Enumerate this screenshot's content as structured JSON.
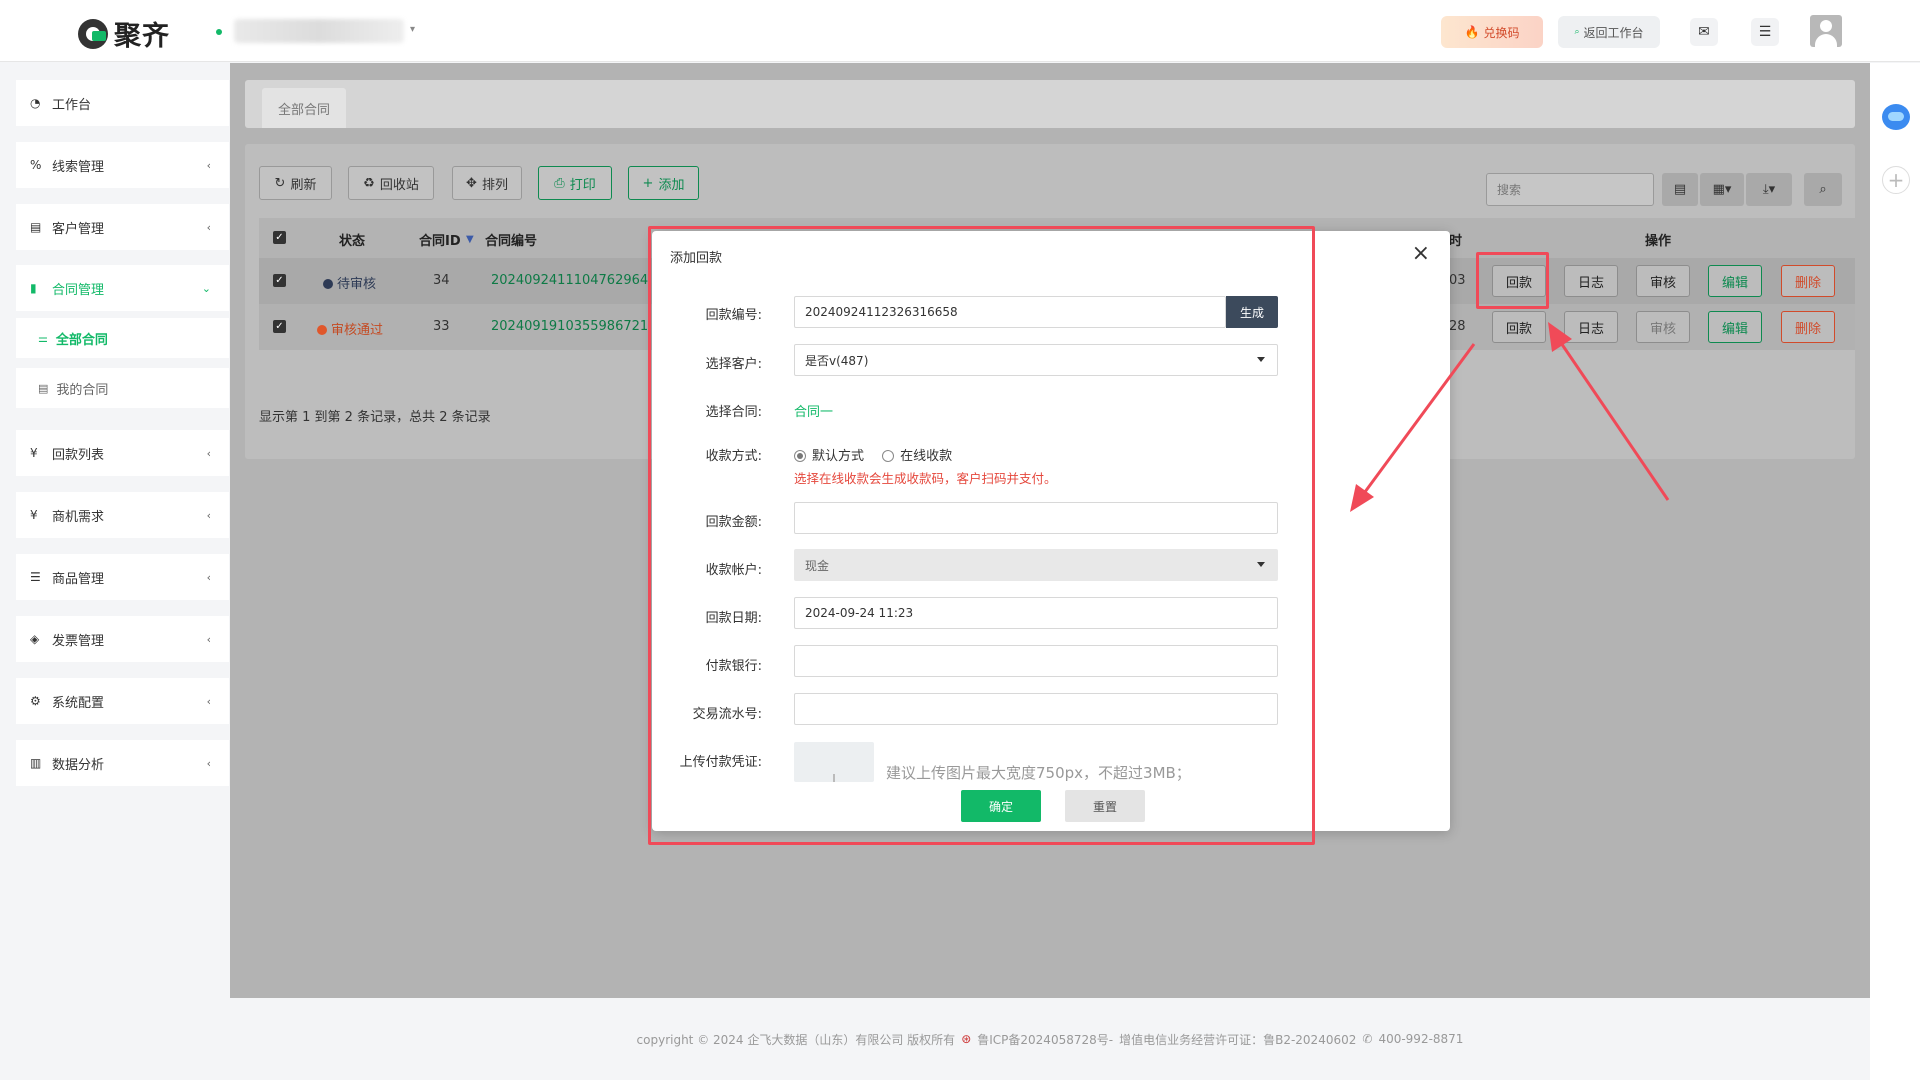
{
  "header": {
    "logo_text": "聚齐",
    "redeem_label": "兑换码",
    "back_label": "返回工作台"
  },
  "sidebar": {
    "items": [
      {
        "label": "工作台",
        "icon": "dashboard-icon"
      },
      {
        "label": "线索管理",
        "icon": "link-icon"
      },
      {
        "label": "客户管理",
        "icon": "id-card-icon"
      },
      {
        "label": "合同管理",
        "icon": "bookmark-icon"
      },
      {
        "label": "回款列表",
        "icon": "yen-icon"
      },
      {
        "label": "商机需求",
        "icon": "yen-icon"
      },
      {
        "label": "商品管理",
        "icon": "list-icon"
      },
      {
        "label": "发票管理",
        "icon": "tag-icon"
      },
      {
        "label": "系统配置",
        "icon": "gears-icon"
      },
      {
        "label": "数据分析",
        "icon": "bar-chart-icon"
      }
    ],
    "sub_items": [
      {
        "label": "全部合同"
      },
      {
        "label": "我的合同"
      }
    ]
  },
  "tabs": [
    "全部合同"
  ],
  "toolbar": {
    "refresh": "刷新",
    "recycle": "回收站",
    "sort": "排列",
    "print": "打印",
    "add": "添加",
    "search_placeholder": "搜索"
  },
  "table": {
    "headers": [
      "状态",
      "合同ID",
      "合同编号",
      "时",
      "操作"
    ],
    "rows": [
      {
        "status": "待审核",
        "status_color": "#2d3a55",
        "id": "34",
        "number": "2024092411104762964",
        "time": "03"
      },
      {
        "status": "审核通过",
        "status_color": "#e0572b",
        "id": "33",
        "number": "2024091910355986721",
        "time": "28"
      }
    ],
    "actions": [
      "回款",
      "日志",
      "审核",
      "编辑",
      "删除"
    ]
  },
  "pagination_text": "显示第 1 到第 2 条记录，总共 2 条记录",
  "modal": {
    "title": "添加回款",
    "fields": {
      "number_label": "回款编号:",
      "number_value": "20240924112326316658",
      "generate": "生成",
      "customer_label": "选择客户:",
      "customer_value": "是否v(487)",
      "contract_label": "选择合同:",
      "contract_value": "合同一",
      "method_label": "收款方式:",
      "method_default": "默认方式",
      "method_online": "在线收款",
      "method_hint": "选择在线收款会生成收款码，客户扫码并支付。",
      "amount_label": "回款金额:",
      "account_label": "收款帐户:",
      "account_value": "现金",
      "date_label": "回款日期:",
      "date_value": "2024-09-24 11:23",
      "bank_label": "付款银行:",
      "serial_label": "交易流水号:",
      "upload_label": "上传付款凭证:",
      "upload_hint": "建议上传图片最大宽度750px，不超过3MB；"
    },
    "confirm": "确定",
    "reset": "重置"
  },
  "footer": {
    "copyright": "copyright © 2024 企飞大数据（山东）有限公司 版权所有",
    "icp": "鲁ICP备2024058728号-",
    "license": "增值电信业务经营许可证：鲁B2-20240602",
    "phone": "400-992-8871"
  },
  "colors": {
    "accent": "#12b968",
    "danger": "#d14b2b",
    "annotation": "#f04a58"
  }
}
